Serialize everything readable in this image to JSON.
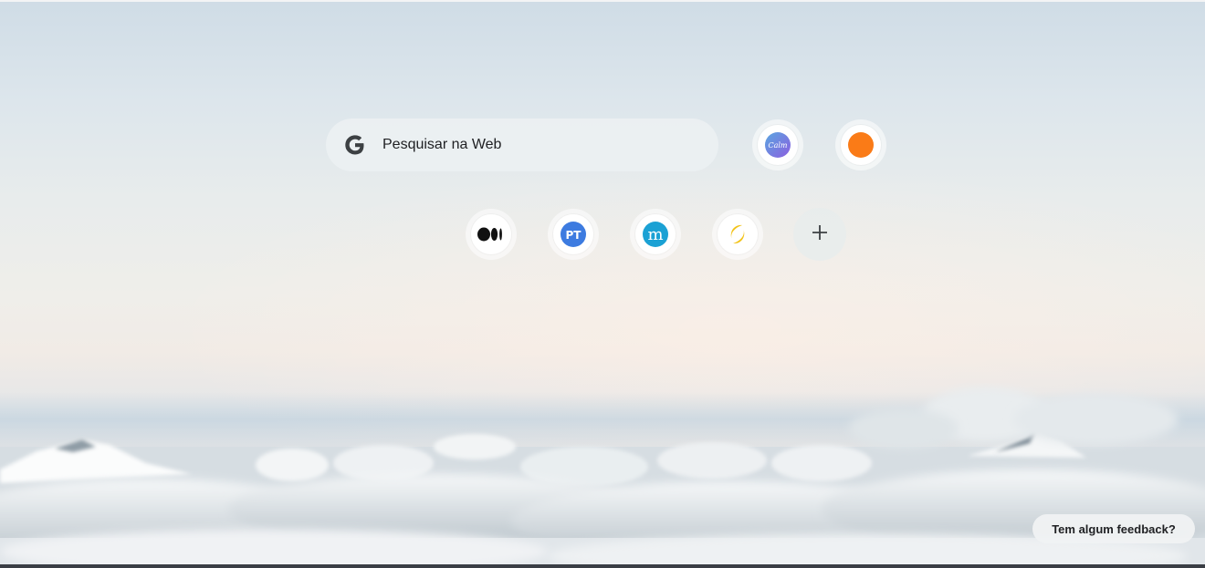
{
  "search": {
    "placeholder": "Pesquisar na Web"
  },
  "shortcuts": [
    {
      "icon": "calm-icon",
      "text": "Calm"
    },
    {
      "icon": "orange-dot-icon"
    },
    {
      "icon": "medium-icon"
    },
    {
      "icon": "pt-icon",
      "text": "PT"
    },
    {
      "icon": "m-logo-icon",
      "text": "m"
    },
    {
      "icon": "crescent-icon"
    }
  ],
  "add_shortcut": {
    "icon": "plus-icon"
  },
  "feedback": {
    "label": "Tem algum feedback?"
  },
  "colors": {
    "calm_gradient_start": "#5aa6e0",
    "calm_gradient_end": "#8b5fe0",
    "orange": "#fa7b17",
    "pt_blue": "#3d7be0",
    "m_blue": "#1ba1d4",
    "crescent": "#f2c319"
  }
}
